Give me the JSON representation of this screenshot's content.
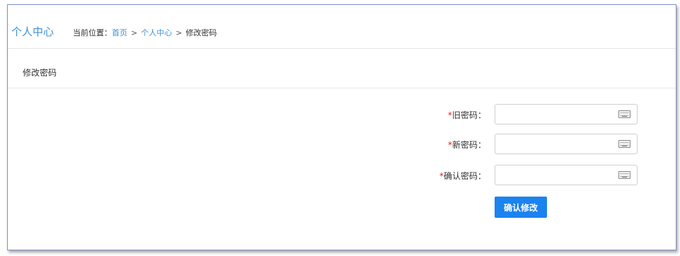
{
  "header": {
    "module_title": "个人中心",
    "breadcrumb_prefix": "当前位置：",
    "breadcrumb": [
      "首页",
      "个人中心",
      "修改密码"
    ],
    "separator": ">"
  },
  "section": {
    "title": "修改密码"
  },
  "form": {
    "required_mark": "*",
    "fields": [
      {
        "label": "旧密码：",
        "value": "",
        "icon": "keyboard-icon"
      },
      {
        "label": "新密码：",
        "value": "",
        "icon": "keyboard-icon"
      },
      {
        "label": "确认密码：",
        "value": "",
        "icon": "keyboard-icon"
      }
    ],
    "submit_label": "确认修改"
  },
  "colors": {
    "accent": "#3d8fd8",
    "button": "#1a83f0",
    "required": "#e02020"
  }
}
